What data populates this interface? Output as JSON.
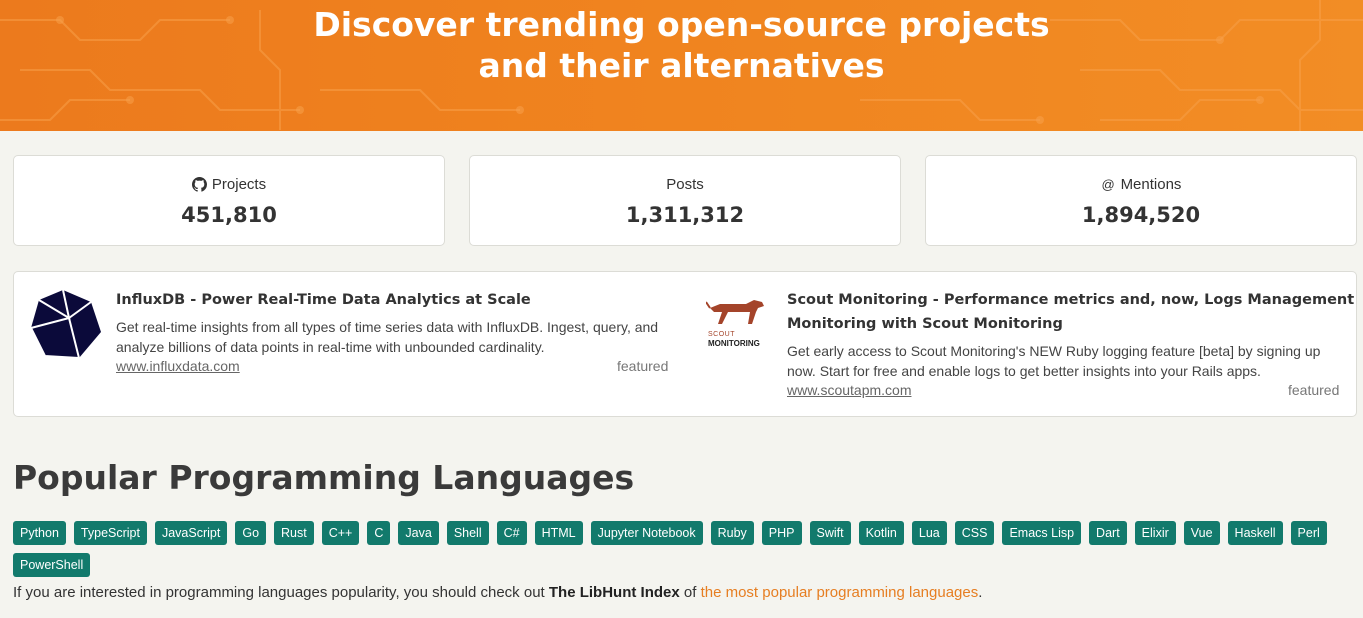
{
  "hero": {
    "title_line1": "Discover trending open-source projects",
    "title_line2": "and their alternatives"
  },
  "stats": [
    {
      "icon": "github-icon",
      "label": "Projects",
      "value": "451,810"
    },
    {
      "icon": "",
      "label": "Posts",
      "value": "1,311,312"
    },
    {
      "icon": "at-icon",
      "label": "Mentions",
      "value": "1,894,520"
    }
  ],
  "ads": [
    {
      "title": "InfluxDB - Power Real-Time Data Analytics at Scale",
      "desc_line1": "Get real-time insights from all types of time series data with InfluxDB. Ingest, query, and",
      "desc_line2": "analyze billions of data points in real-time with unbounded cardinality.",
      "link": "www.influxdata.com",
      "badge": "featured",
      "logo": "influxdb-logo"
    },
    {
      "title_line1": "Scout Monitoring - Performance metrics and, now, Logs Management",
      "title_line2": "Monitoring with Scout Monitoring",
      "desc_line1": "Get early access to Scout Monitoring's NEW Ruby logging feature [beta] by signing up",
      "desc_line2": "now. Start for free and enable logs to get better insights into your Rails apps.",
      "link": "www.scoutapm.com",
      "badge": "featured",
      "logo_text1": "SCOUT",
      "logo_text2": "MONITORING"
    }
  ],
  "languages_section": {
    "title": "Popular Programming Languages",
    "tags": [
      "Python",
      "TypeScript",
      "JavaScript",
      "Go",
      "Rust",
      "C++",
      "C",
      "Java",
      "Shell",
      "C#",
      "HTML",
      "Jupyter Notebook",
      "Ruby",
      "PHP",
      "Swift",
      "Kotlin",
      "Lua",
      "CSS",
      "Emacs Lisp",
      "Dart",
      "Elixir",
      "Vue",
      "Haskell",
      "Perl",
      "PowerShell"
    ],
    "footer_prefix": "If you are interested in programming languages popularity, you should check out ",
    "footer_bold": "The LibHunt Index",
    "footer_mid": " of ",
    "footer_link": "the most popular programming languages",
    "footer_suffix": "."
  },
  "colors": {
    "hero_orange": "#f0841f",
    "tag_teal": "#127a6c",
    "link_orange": "#e67e22",
    "influx_navy": "#0b0a3a",
    "scout_brown": "#a4442a"
  }
}
